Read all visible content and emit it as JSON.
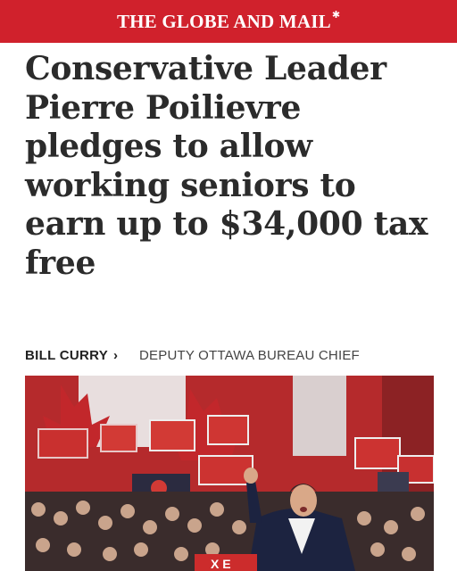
{
  "masthead": {
    "title": "THE GLOBE AND MAIL",
    "logo_icon": "maple-leaf-icon",
    "background": "#d0212c"
  },
  "article": {
    "headline": "Conservative Leader Pierre Poilievre pledges to allow working seniors to earn up to $34,000 tax free",
    "author": "BILL CURRY",
    "author_chevron": "›",
    "author_title": "DEPUTY OTTAWA BUREAU CHIEF"
  },
  "photo": {
    "description_icon": "rally-photo",
    "sign_text": "X E"
  }
}
